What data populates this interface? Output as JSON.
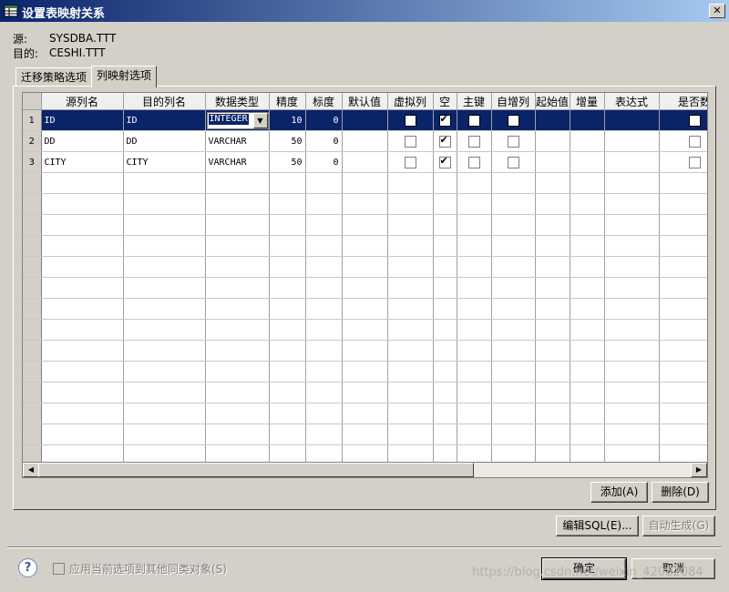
{
  "window": {
    "title": "设置表映射关系",
    "close_label": "✕"
  },
  "source": {
    "label": "源:",
    "value": "SYSDBA.TTT"
  },
  "target": {
    "label": "目的:",
    "value": "CESHI.TTT"
  },
  "tabs": [
    {
      "label": "迁移策略选项"
    },
    {
      "label": "列映射选项"
    }
  ],
  "grid": {
    "columns": [
      "源列名",
      "目的列名",
      "数据类型",
      "精度",
      "标度",
      "默认值",
      "虚拟列",
      "空",
      "主键",
      "自增列",
      "起始值",
      "增量",
      "表达式",
      "是否数"
    ],
    "rows": [
      {
        "index": "1",
        "src": "ID",
        "dst": "ID",
        "type": "INTEGER",
        "precision": "10",
        "scale": "0",
        "default": "",
        "virtual": false,
        "nullable": true,
        "pk": false,
        "identity": false,
        "is_data": false,
        "selected": true
      },
      {
        "index": "2",
        "src": "DD",
        "dst": "DD",
        "type": "VARCHAR",
        "precision": "50",
        "scale": "0",
        "default": "",
        "virtual": false,
        "nullable": true,
        "pk": false,
        "identity": false,
        "is_data": false,
        "selected": false
      },
      {
        "index": "3",
        "src": "CITY",
        "dst": "CITY",
        "type": "VARCHAR",
        "precision": "50",
        "scale": "0",
        "default": "",
        "virtual": false,
        "nullable": true,
        "pk": false,
        "identity": false,
        "is_data": false,
        "selected": false
      }
    ],
    "empty_rows": 14
  },
  "buttons": {
    "add": "添加(A)",
    "delete": "删除(D)",
    "edit_sql": "编辑SQL(E)...",
    "auto_generate": "自动生成(G)",
    "ok": "确定",
    "cancel": "取消"
  },
  "footer": {
    "apply_all_label": "应用当前选项到其他同类对象(S)",
    "help_icon": "?"
  },
  "watermark": "https://blog.csdn.net/weixin_42082084"
}
